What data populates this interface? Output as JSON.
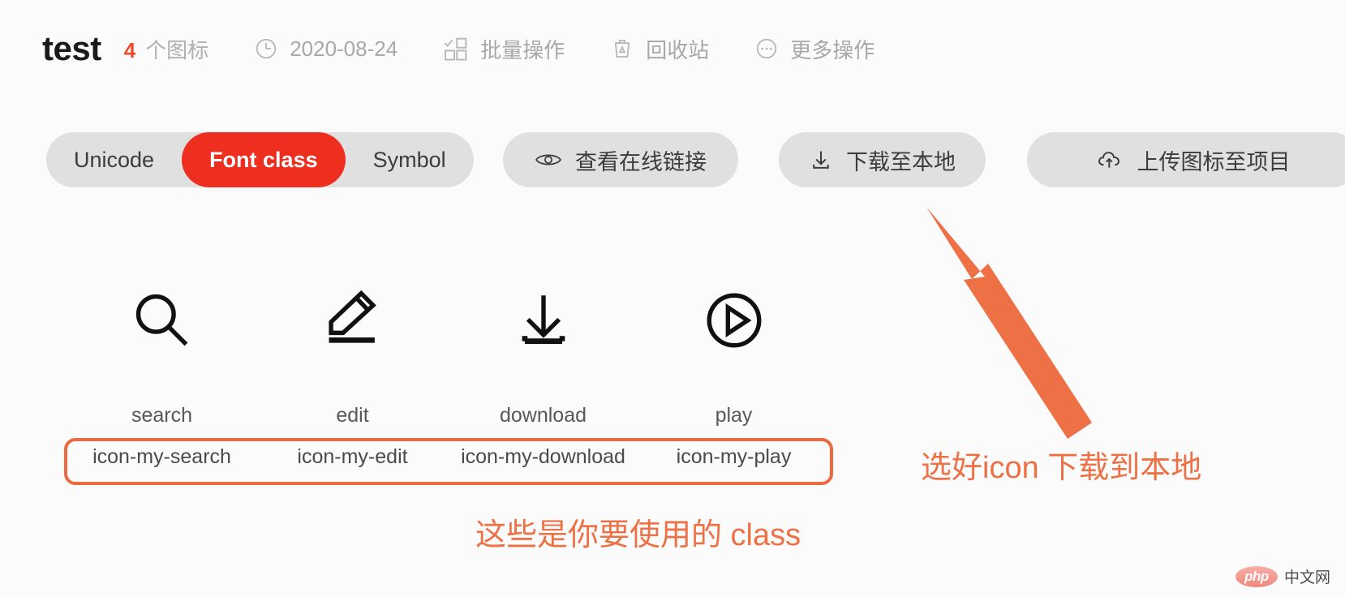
{
  "header": {
    "project_name": "test",
    "icon_count": "4",
    "icon_count_unit": "个图标",
    "date": "2020-08-24",
    "batch_action": "批量操作",
    "recycle_bin": "回收站",
    "more_actions": "更多操作",
    "icons": {
      "clock": "clock-icon",
      "batch": "batch-select-icon",
      "trash": "trash-icon",
      "more": "ellipsis-circle-icon"
    },
    "accent_color": "#f04a28",
    "muted_color": "#a8a8a8"
  },
  "toolbar": {
    "tabs": [
      {
        "label": "Unicode",
        "active": false
      },
      {
        "label": "Font class",
        "active": true
      },
      {
        "label": "Symbol",
        "active": false
      }
    ],
    "active_tab_color": "#ee2f20",
    "buttons": [
      {
        "label": "查看在线链接",
        "icon": "eye-icon"
      },
      {
        "label": "下载至本地",
        "icon": "download-icon"
      },
      {
        "label": "上传图标至项目",
        "icon": "cloud-upload-icon"
      }
    ]
  },
  "icon_grid": [
    {
      "name": "search",
      "class_name": "icon-my-search",
      "glyph": "magnifier-icon"
    },
    {
      "name": "edit",
      "class_name": "icon-my-edit",
      "glyph": "pencil-icon"
    },
    {
      "name": "download",
      "class_name": "icon-my-download",
      "glyph": "download-arrow-icon"
    },
    {
      "name": "play",
      "class_name": "icon-my-play",
      "glyph": "play-circle-icon"
    }
  ],
  "annotations": {
    "class_note": "这些是你要使用的 class",
    "download_note": "选好icon 下载到本地",
    "color": "#ee7146",
    "highlight_border_color": "#ec6941"
  },
  "watermark": {
    "badge": "php",
    "text": "中文网"
  }
}
